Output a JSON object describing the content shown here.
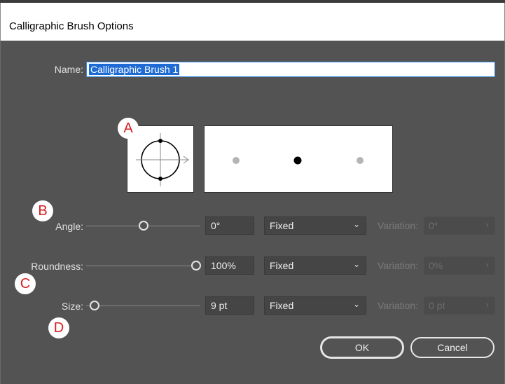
{
  "window": {
    "title": "Calligraphic Brush Options"
  },
  "name": {
    "label": "Name:",
    "value": "Calligraphic Brush 1"
  },
  "markers": {
    "a": "A",
    "b": "B",
    "c": "C",
    "d": "D"
  },
  "rows": {
    "angle": {
      "label": "Angle:",
      "value": "0°",
      "mode": "Fixed",
      "variation_label": "Variation:",
      "variation_value": "0°",
      "slider_fraction": 0.5
    },
    "roundness": {
      "label": "Roundness:",
      "value": "100%",
      "mode": "Fixed",
      "variation_label": "Variation:",
      "variation_value": "0%",
      "slider_fraction": 1.0
    },
    "size": {
      "label": "Size:",
      "value": "9 pt",
      "mode": "Fixed",
      "variation_label": "Variation:",
      "variation_value": "0 pt",
      "slider_fraction": 0.0
    }
  },
  "icons": {
    "dropdown": "chevron-down-icon",
    "variation_arrow": "chevron-right-icon"
  },
  "buttons": {
    "ok": "OK",
    "cancel": "Cancel"
  },
  "colors": {
    "dialog_bg": "#535353",
    "marker_text": "#d81e1e",
    "selection": "#1e6bd6"
  }
}
